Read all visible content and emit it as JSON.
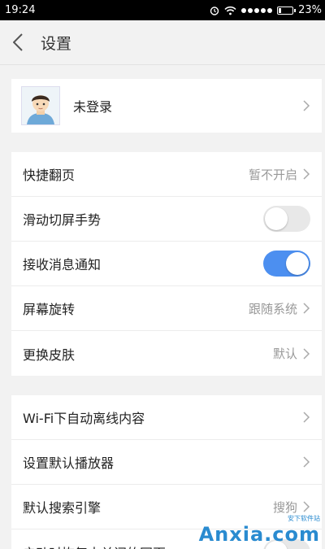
{
  "status_bar": {
    "time": "19:24",
    "battery_text": "23%",
    "battery_level": 0.23,
    "signal_dots": 5
  },
  "header": {
    "title": "设置",
    "back_icon": "chevron-left-icon"
  },
  "profile": {
    "name": "未登录",
    "avatar_icon": "default-avatar"
  },
  "settings_group_1": [
    {
      "label": "快捷翻页",
      "value": "暂不开启",
      "type": "link"
    },
    {
      "label": "滑动切屏手势",
      "type": "toggle",
      "on": false
    },
    {
      "label": "接收消息通知",
      "type": "toggle",
      "on": true
    },
    {
      "label": "屏幕旋转",
      "value": "跟随系统",
      "type": "link"
    },
    {
      "label": "更换皮肤",
      "value": "默认",
      "type": "link"
    }
  ],
  "settings_group_2": [
    {
      "label": "Wi-Fi下自动离线内容",
      "type": "link"
    },
    {
      "label": "设置默认播放器",
      "type": "link"
    },
    {
      "label": "默认搜索引擎",
      "value": "搜狗",
      "type": "link"
    },
    {
      "label": "启动时恢复未关闭的网页",
      "type": "toggle",
      "on": false
    }
  ],
  "watermark": {
    "main": "Anxia.com",
    "sub": "安下软件站"
  },
  "colors": {
    "accent": "#4c8ff0",
    "background": "#f2f2f2"
  }
}
